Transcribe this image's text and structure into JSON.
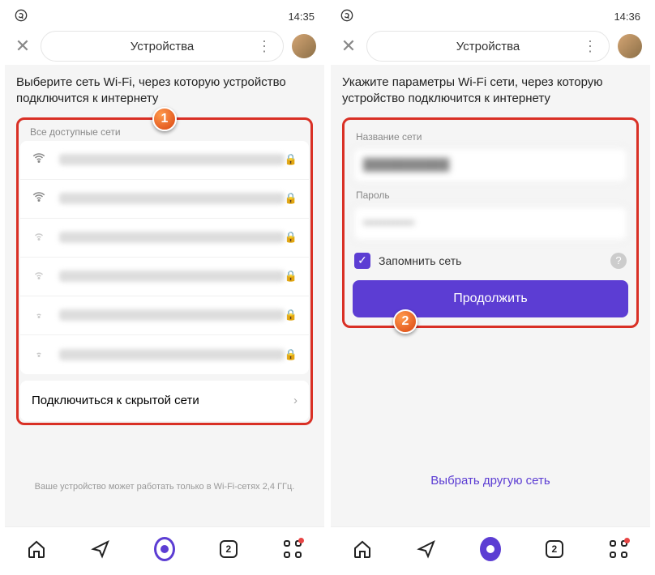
{
  "screen1": {
    "status_time": "14:35",
    "header_title": "Устройства",
    "instruction": "Выберите сеть Wi-Fi, через которую устройство подключится к интернету",
    "section_label": "Все доступные сети",
    "hidden_network_label": "Подключиться к скрытой сети",
    "footer_note": "Ваше устройство может работать только в Wi-Fi-сетях 2,4 ГГц.",
    "callout": "1",
    "nav_badge": "2"
  },
  "screen2": {
    "status_time": "14:36",
    "header_title": "Устройства",
    "instruction": "Укажите параметры Wi-Fi сети, через которую устройство подключится к интернету",
    "ssid_label": "Название сети",
    "ssid_value": "██████████",
    "password_label": "Пароль",
    "password_value": "████████████",
    "remember_label": "Запомнить сеть",
    "continue_label": "Продолжить",
    "select_other_label": "Выбрать другую сеть",
    "callout": "2",
    "nav_badge": "2"
  }
}
